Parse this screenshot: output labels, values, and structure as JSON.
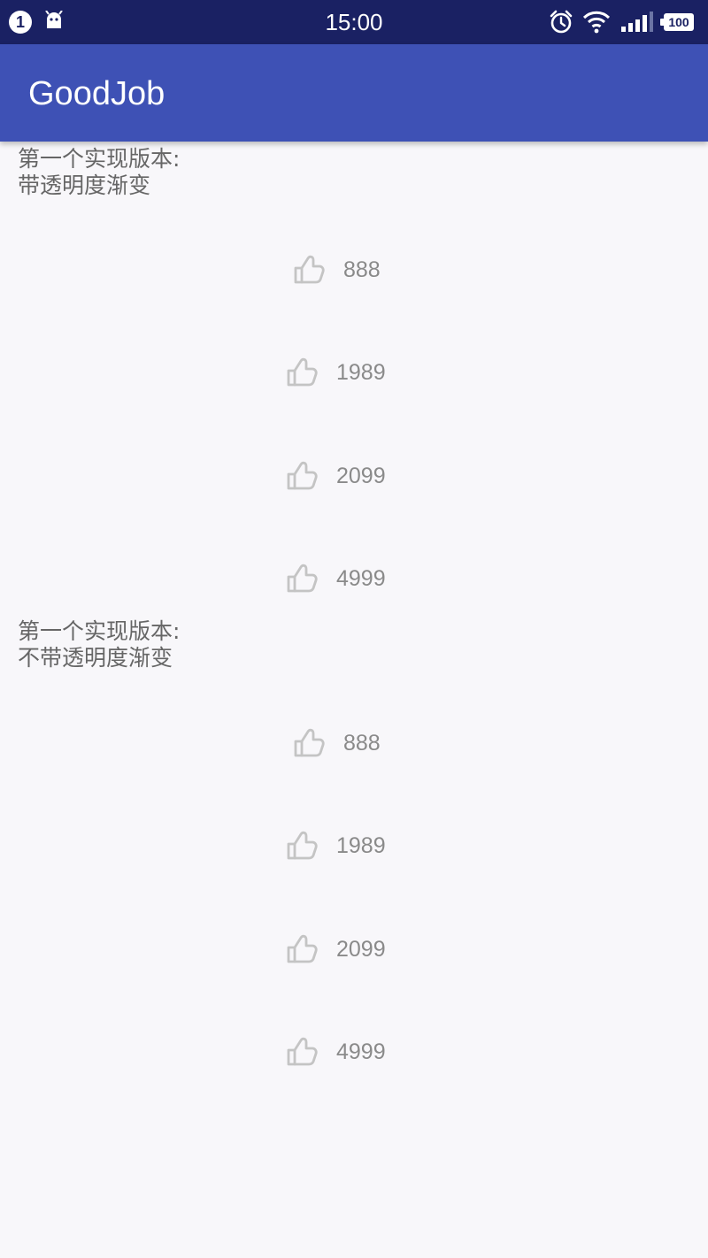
{
  "status_bar": {
    "notification_count": "1",
    "time": "15:00",
    "battery": "100",
    "icons": [
      "android-icon",
      "alarm-icon",
      "wifi-icon",
      "signal-icon",
      "battery-icon"
    ]
  },
  "app_bar": {
    "title": "GoodJob"
  },
  "sections": [
    {
      "label": "第一个实现版本:\n带透明度渐变",
      "items": [
        {
          "count": "888",
          "icon": "thumbs-up-icon"
        },
        {
          "count": "1989",
          "icon": "thumbs-up-icon"
        },
        {
          "count": "2099",
          "icon": "thumbs-up-icon"
        },
        {
          "count": "4999",
          "icon": "thumbs-up-icon"
        }
      ]
    },
    {
      "label": "第一个实现版本:\n不带透明度渐变",
      "items": [
        {
          "count": "888",
          "icon": "thumbs-up-icon"
        },
        {
          "count": "1989",
          "icon": "thumbs-up-icon"
        },
        {
          "count": "2099",
          "icon": "thumbs-up-icon"
        },
        {
          "count": "4999",
          "icon": "thumbs-up-icon"
        }
      ]
    }
  ],
  "colors": {
    "status_bar": "#1a2163",
    "app_bar": "#3e51b5",
    "background": "#f8f7fa",
    "count_text": "#8a8a8a",
    "icon": "#c4c4c4"
  }
}
